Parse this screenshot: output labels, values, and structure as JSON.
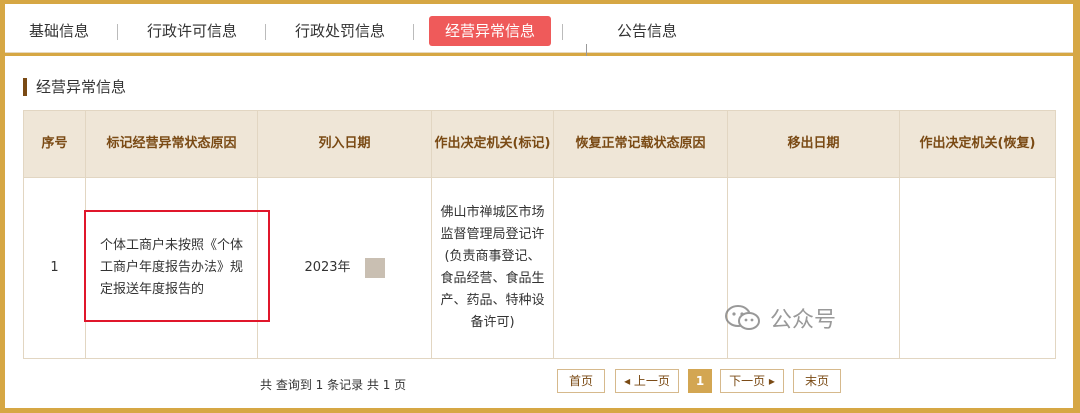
{
  "tabs": [
    {
      "label": "基础信息",
      "active": false
    },
    {
      "label": "行政许可信息",
      "active": false
    },
    {
      "label": "行政处罚信息",
      "active": false
    },
    {
      "label": "经营异常信息",
      "active": true
    },
    {
      "label": "公告信息",
      "active": false
    }
  ],
  "section_title": "经营异常信息",
  "table": {
    "headers": [
      "序号",
      "标记经营异常状态原因",
      "列入日期",
      "作出决定机关(标记)",
      "恢复正常记载状态原因",
      "移出日期",
      "作出决定机关(恢复)"
    ],
    "rows": [
      {
        "index": "1",
        "reason": "个体工商户未按照《个体工商户年度报告办法》规定报送年度报告的",
        "date_in": "2023年",
        "authority_line1": "佛山市禅城区市场监督管理局登记许",
        "authority_line2": "(负责商事登记、食品经营、食品生产、药品、特种设备许可)",
        "restore_reason": "",
        "date_out": "",
        "authority_restore": ""
      }
    ]
  },
  "pagination": {
    "summary": "共 查询到 1 条记录 共 1 页",
    "first": "首页",
    "prev": "上一页",
    "current": "1",
    "next": "下一页",
    "last": "末页"
  },
  "watermark": "公众号",
  "colors": {
    "frame": "#d6a744",
    "active_tab": "#ef5a5a",
    "header_bg": "#efe6d7",
    "header_text": "#7a4a14",
    "highlight_box": "#e0162b",
    "page_current": "#d3a652"
  }
}
